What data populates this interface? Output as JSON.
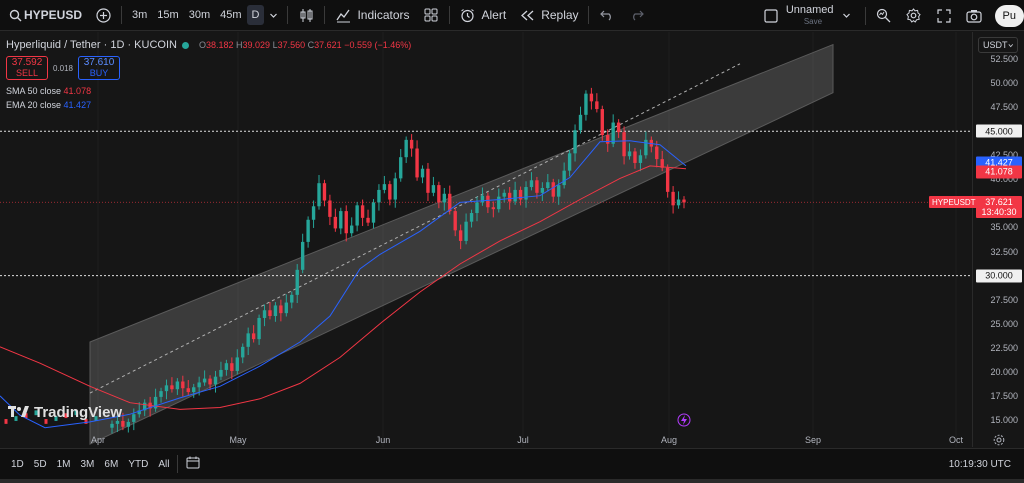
{
  "toolbar": {
    "symbol": "HYPEUSD",
    "intervals": [
      "3m",
      "15m",
      "30m",
      "45m",
      "D"
    ],
    "active_interval": "D",
    "indicators_label": "Indicators",
    "alert_label": "Alert",
    "replay_label": "Replay",
    "layout_name": "Unnamed",
    "layout_status": "Save",
    "publish_label": "Pu"
  },
  "legend": {
    "title": "Hyperliquid / Tether · 1D · KUCOIN",
    "open_label": "O",
    "open": "38.182",
    "high_label": "H",
    "high": "39.029",
    "low_label": "L",
    "low": "37.560",
    "close_label": "C",
    "close": "37.621",
    "change": "−0.559 (−1.46%)",
    "sell_price": "37.592",
    "sell_label": "SELL",
    "spread": "0.018",
    "buy_price": "37.610",
    "buy_label": "BUY",
    "sma_label": "SMA 50 close",
    "sma_value": "41.078",
    "ema_label": "EMA 20 close",
    "ema_value": "41.427"
  },
  "price_scale": {
    "currency": "USDT",
    "ticks": [
      "52.500",
      "50.000",
      "47.500",
      "45.000",
      "42.500",
      "40.000",
      "37.500",
      "35.000",
      "32.500",
      "30.000",
      "27.500",
      "25.000",
      "22.500",
      "20.000",
      "17.500",
      "15.000"
    ],
    "tick_values": [
      52.5,
      50,
      47.5,
      45,
      42.5,
      40,
      37.5,
      35,
      32.5,
      30,
      27.5,
      25,
      22.5,
      20,
      17.5,
      15
    ],
    "hline_upper": "45.000",
    "hline_lower": "30.000",
    "ema_tag": "41.427",
    "sma_tag": "41.078",
    "symbol_tag": "HYPEUSDT",
    "price_tag": "37.621",
    "countdown": "13:40:30"
  },
  "time_axis": [
    "Apr",
    "May",
    "Jun",
    "Jul",
    "Aug",
    "Sep",
    "Oct"
  ],
  "bottom": {
    "ranges": [
      "1D",
      "5D",
      "1M",
      "3M",
      "6M",
      "YTD",
      "All"
    ],
    "clock": "10:19:30 UTC"
  },
  "brand": "TradingView",
  "colors": {
    "up": "#26a69a",
    "down": "#f23645",
    "sma": "#f23645",
    "ema": "#2962ff",
    "channel": "#5a5a5a"
  },
  "chart_data": {
    "type": "candlestick",
    "symbol": "HYPEUSDT",
    "interval": "1D",
    "ylim": [
      13.5,
      54
    ],
    "x_labels": [
      "Apr",
      "May",
      "Jun",
      "Jul",
      "Aug",
      "Sep",
      "Oct"
    ],
    "last_price": 37.621,
    "series": [
      {
        "name": "SMA 50 close",
        "last": 41.078
      },
      {
        "name": "EMA 20 close",
        "last": 41.427
      }
    ],
    "horizontal_lines": [
      45.0,
      30.0,
      37.621
    ],
    "close_path": [
      14.6,
      14.9,
      14.3,
      14.8,
      15.6,
      16.0,
      16.8,
      16.2,
      17.4,
      18.0,
      18.6,
      18.2,
      19.0,
      18.3,
      17.9,
      18.4,
      18.9,
      19.3,
      18.7,
      19.5,
      20.2,
      20.9,
      20.1,
      21.5,
      22.6,
      24.0,
      23.4,
      25.6,
      26.4,
      25.8,
      26.9,
      26.1,
      27.2,
      28.0,
      30.6,
      33.5,
      35.8,
      37.2,
      39.6,
      37.8,
      36.1,
      34.9,
      36.7,
      34.4,
      35.2,
      37.3,
      36.0,
      35.5,
      37.6,
      38.9,
      39.5,
      37.9,
      40.1,
      42.3,
      44.1,
      43.2,
      40.2,
      41.1,
      38.6,
      39.4,
      37.6,
      38.5,
      36.7,
      34.7,
      33.6,
      35.6,
      36.5,
      37.6,
      38.3,
      37.1,
      36.9,
      38.2,
      38.6,
      37.7,
      38.9,
      37.9,
      39.2,
      39.9,
      38.6,
      39.1,
      39.7,
      38.2,
      39.4,
      40.9,
      42.7,
      45.1,
      46.7,
      48.9,
      48.1,
      47.3,
      44.6,
      43.7,
      45.9,
      44.9,
      42.4,
      42.9,
      41.7,
      42.5,
      44.1,
      43.4,
      42.1,
      41.2,
      38.7,
      37.3,
      37.9,
      37.6
    ]
  }
}
